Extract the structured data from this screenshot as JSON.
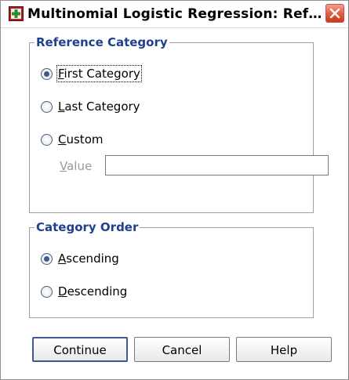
{
  "window": {
    "title": "Multinomial Logistic Regression: Ref…"
  },
  "reference_category": {
    "legend": "Reference Category",
    "options": [
      {
        "label": "First Category",
        "selected": true
      },
      {
        "label": "Last Category",
        "selected": false
      },
      {
        "label": "Custom",
        "selected": false
      }
    ],
    "value_label": "Value",
    "value": ""
  },
  "category_order": {
    "legend": "Category Order",
    "options": [
      {
        "label": "Ascending",
        "selected": true
      },
      {
        "label": "Descending",
        "selected": false
      }
    ]
  },
  "buttons": {
    "continue": "Continue",
    "cancel": "Cancel",
    "help": "Help"
  }
}
